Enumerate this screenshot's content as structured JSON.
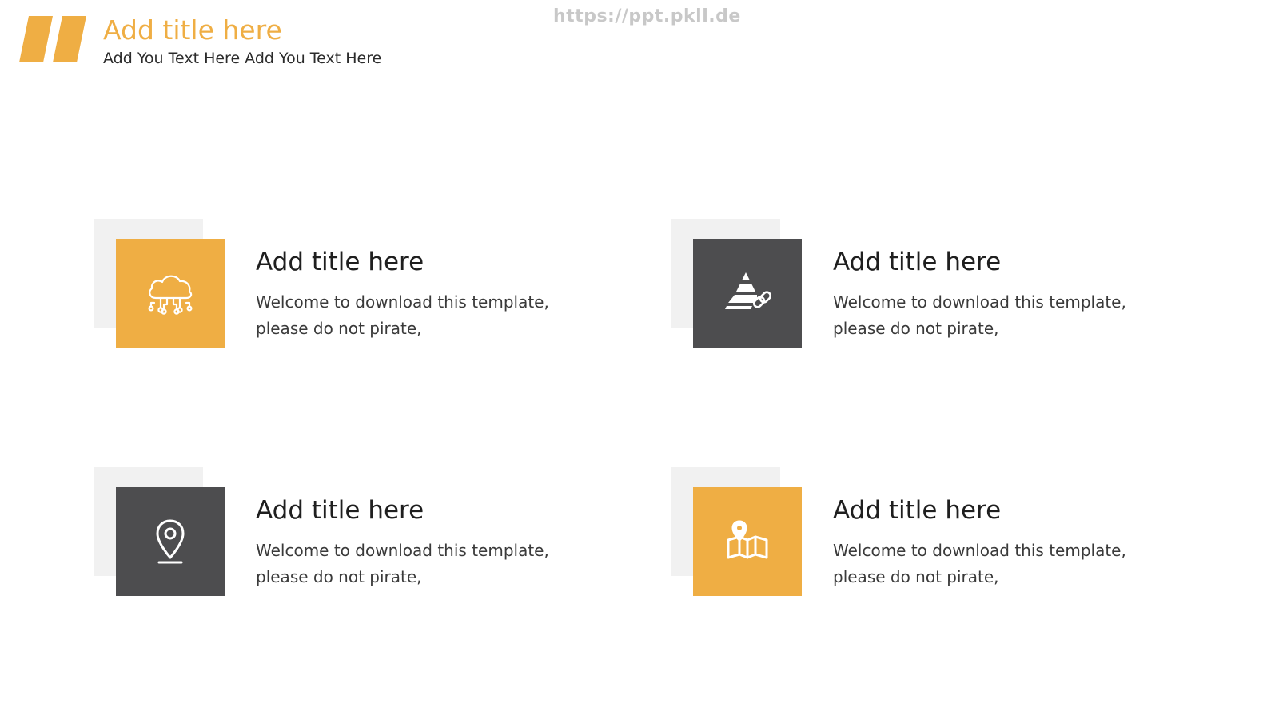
{
  "header": {
    "title": "Add title here",
    "subtitle": "Add You Text Here Add You Text Here",
    "watermark": "https://ppt.pkll.de",
    "accent_color": "#efae44"
  },
  "cards": [
    {
      "icon": "cloud-network-icon",
      "icon_bg": "orange",
      "title": "Add title here",
      "body_line1": "Welcome to download this template,",
      "body_line2": "please do not pirate,"
    },
    {
      "icon": "pyramid-link-icon",
      "icon_bg": "dark",
      "title": "Add title here",
      "body_line1": "Welcome to download this template,",
      "body_line2": "please do not pirate,"
    },
    {
      "icon": "location-pin-icon",
      "icon_bg": "dark",
      "title": "Add title here",
      "body_line1": "Welcome to download this template,",
      "body_line2": "please do not pirate,"
    },
    {
      "icon": "map-pin-icon",
      "icon_bg": "orange",
      "title": "Add title here",
      "body_line1": "Welcome to download this template,",
      "body_line2": "please do not pirate,"
    }
  ],
  "colors": {
    "orange": "#efae44",
    "dark": "#4d4d4f",
    "shadow": "#f1f1f1"
  }
}
